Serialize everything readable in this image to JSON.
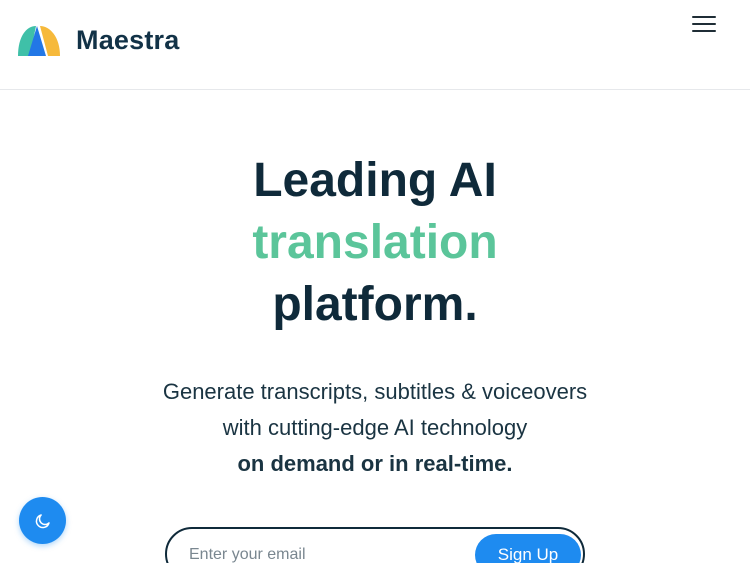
{
  "header": {
    "brand_name": "Maestra",
    "menu_icon": "hamburger-menu-icon"
  },
  "hero": {
    "title_line1": "Leading AI",
    "title_accent": "translation",
    "title_line3": "platform.",
    "accent_color": "#5bc59a"
  },
  "subtitle": {
    "line1": "Generate transcripts, subtitles & voiceovers",
    "line2": "with cutting-edge AI technology",
    "line3_bold": "on demand or in real-time."
  },
  "signup": {
    "email_placeholder": "Enter your email",
    "button_label": "Sign Up",
    "button_color": "#1e8bf0"
  },
  "theme_toggle": {
    "icon": "moon-icon"
  }
}
